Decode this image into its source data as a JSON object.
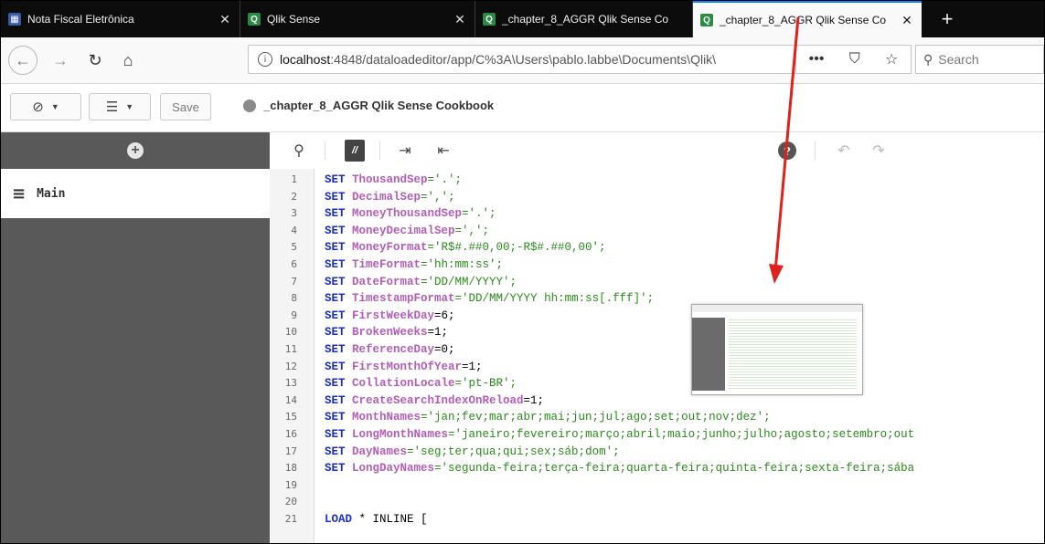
{
  "browser": {
    "tabs": [
      {
        "label": "Nota Fiscal Eletrônica",
        "favicon": "government-favicon",
        "active": false
      },
      {
        "label": "Qlik Sense",
        "favicon": "qlik-favicon",
        "active": false
      },
      {
        "label": "_chapter_8_AGGR Qlik Sense Co",
        "favicon": "qlik-favicon",
        "active": false
      },
      {
        "label": "_chapter_8_AGGR Qlik Sense Co",
        "favicon": "qlik-favicon",
        "active": true
      }
    ],
    "close_glyph": "✕",
    "new_tab_glyph": "+",
    "url_host": "localhost",
    "url_path": ":4848/dataloadeditor/app/C%3A\\Users\\pablo.labbe\\Documents\\Qlik\\",
    "page_actions": [
      "•••",
      "⛉",
      "☆"
    ],
    "search_placeholder": "Search"
  },
  "qlik_toolbar": {
    "save_label": "Save",
    "app_title": "_chapter_8_AGGR Qlik Sense Cookbook"
  },
  "left_panel": {
    "section_label": "Main"
  },
  "editor": {
    "lines": [
      {
        "n": "1",
        "kw": "SET ",
        "var": "ThousandSep",
        "rest": "='.';"
      },
      {
        "n": "2",
        "kw": "SET ",
        "var": "DecimalSep",
        "rest": "=',';"
      },
      {
        "n": "3",
        "kw": "SET ",
        "var": "MoneyThousandSep",
        "rest": "='.';"
      },
      {
        "n": "4",
        "kw": "SET ",
        "var": "MoneyDecimalSep",
        "rest": "=',';"
      },
      {
        "n": "5",
        "kw": "SET ",
        "var": "MoneyFormat",
        "rest": "='R$#.##0,00;-R$#.##0,00';"
      },
      {
        "n": "6",
        "kw": "SET ",
        "var": "TimeFormat",
        "rest": "='hh:mm:ss';"
      },
      {
        "n": "7",
        "kw": "SET ",
        "var": "DateFormat",
        "rest": "='DD/MM/YYYY';"
      },
      {
        "n": "8",
        "kw": "SET ",
        "var": "TimestampFormat",
        "rest": "='DD/MM/YYYY hh:mm:ss[.fff]';"
      },
      {
        "n": "9",
        "kw": "SET ",
        "var": "FirstWeekDay",
        "rest": "=6;"
      },
      {
        "n": "10",
        "kw": "SET ",
        "var": "BrokenWeeks",
        "rest": "=1;"
      },
      {
        "n": "11",
        "kw": "SET ",
        "var": "ReferenceDay",
        "rest": "=0;"
      },
      {
        "n": "12",
        "kw": "SET ",
        "var": "FirstMonthOfYear",
        "rest": "=1;"
      },
      {
        "n": "13",
        "kw": "SET ",
        "var": "CollationLocale",
        "rest": "='pt-BR';"
      },
      {
        "n": "14",
        "kw": "SET ",
        "var": "CreateSearchIndexOnReload",
        "rest": "=1;"
      },
      {
        "n": "15",
        "kw": "SET ",
        "var": "MonthNames",
        "rest": "='jan;fev;mar;abr;mai;jun;jul;ago;set;out;nov;dez';"
      },
      {
        "n": "16",
        "kw": "SET ",
        "var": "LongMonthNames",
        "rest": "='janeiro;fevereiro;março;abril;maio;junho;julho;agosto;setembro;out"
      },
      {
        "n": "17",
        "kw": "SET ",
        "var": "DayNames",
        "rest": "='seg;ter;qua;qui;sex;sáb;dom';"
      },
      {
        "n": "18",
        "kw": "SET ",
        "var": "LongDayNames",
        "rest": "='segunda-feira;terça-feira;quarta-feira;quinta-feira;sexta-feira;sába"
      },
      {
        "n": "19",
        "kw": "",
        "var": "",
        "rest": ""
      },
      {
        "n": "20",
        "kw": "",
        "var": "",
        "rest": ""
      },
      {
        "n": "21",
        "kw": "LOAD",
        "var": "",
        "rest": " * INLINE ["
      }
    ]
  },
  "colors": {
    "keyword": "#1a2fbf",
    "variable": "#b35cb8",
    "string": "#2a8a1a",
    "annotation_arrow": "#e0201b",
    "tab_active_indicator": "#0a84ff"
  }
}
